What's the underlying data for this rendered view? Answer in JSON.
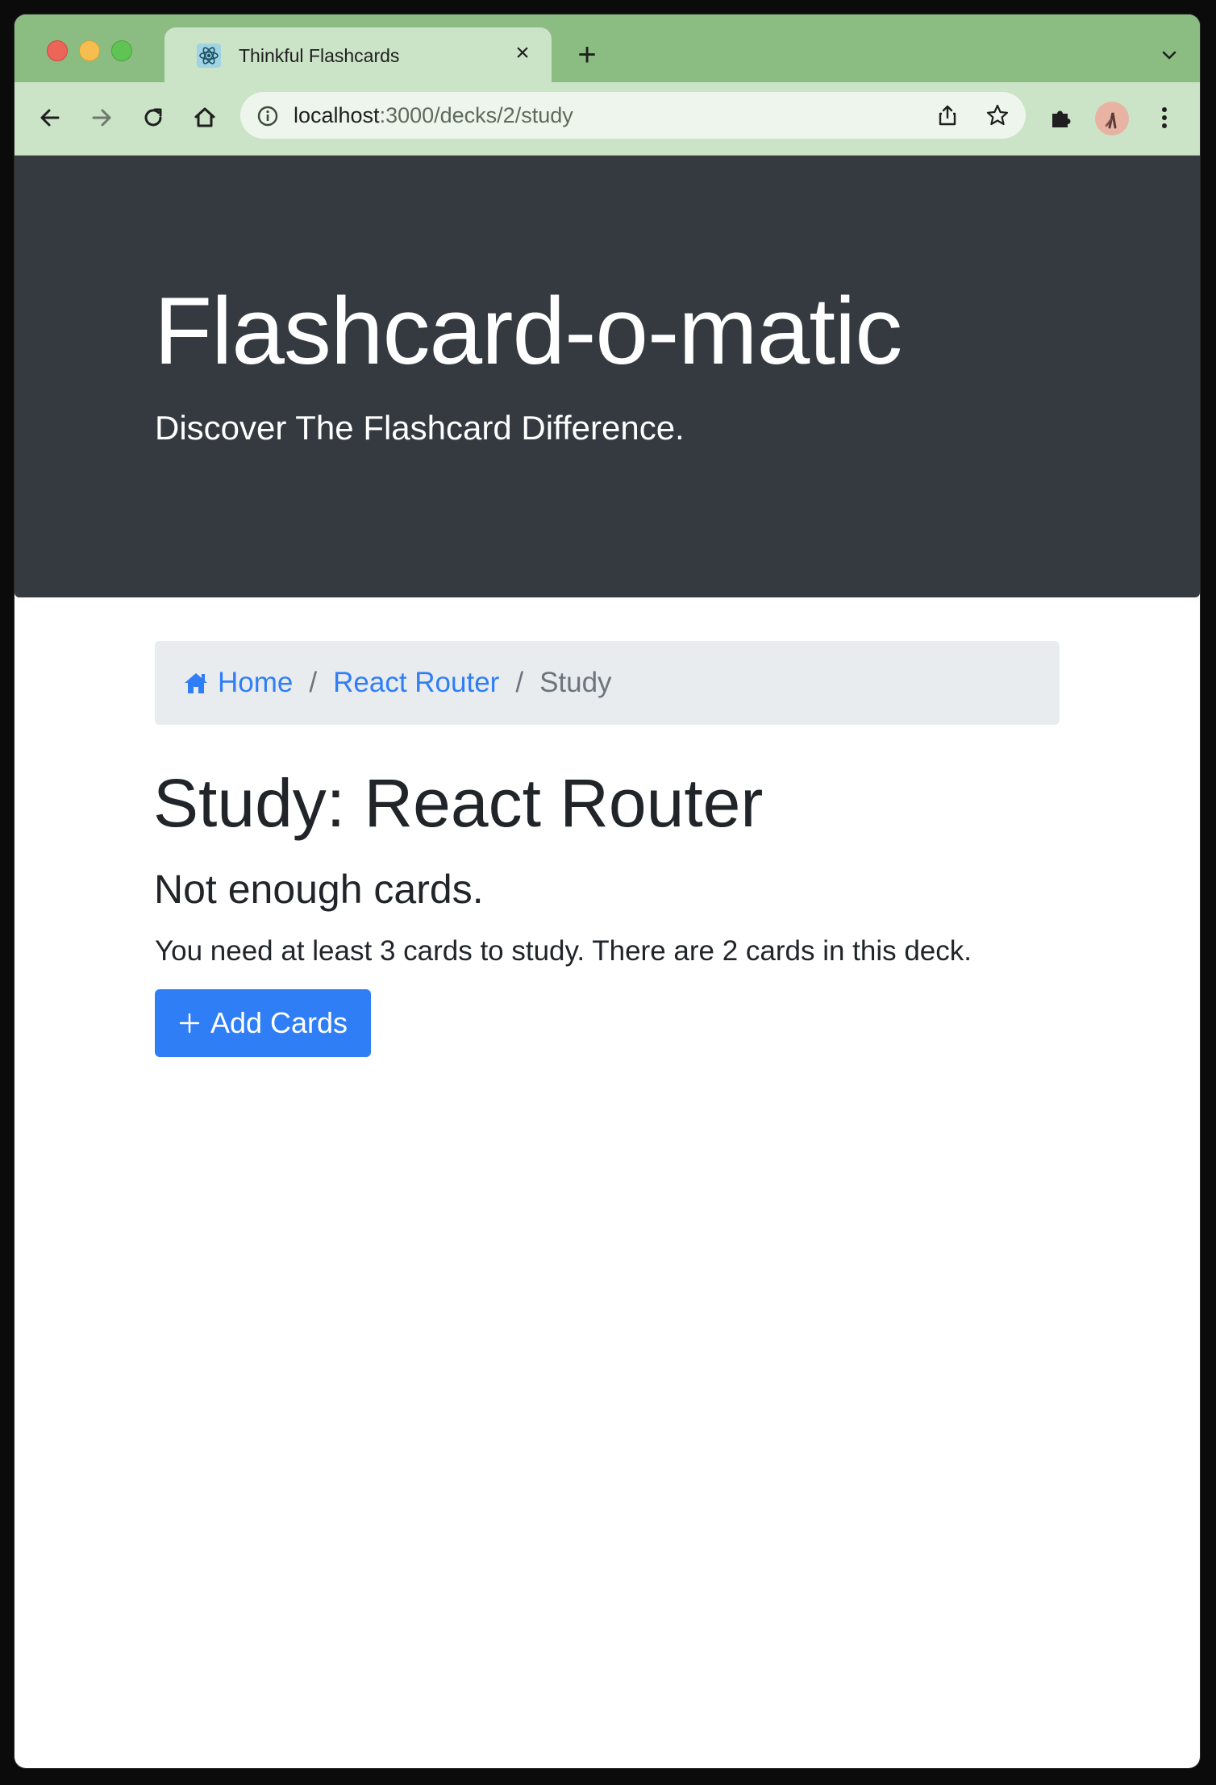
{
  "browser": {
    "tab": {
      "title": "Thinkful Flashcards",
      "favicon": "react-icon"
    },
    "url": {
      "host": "localhost",
      "path": ":3000/decks/2/study"
    }
  },
  "header": {
    "title": "Flashcard-o-matic",
    "subtitle": "Discover The Flashcard Difference."
  },
  "breadcrumb": {
    "home": "Home",
    "deck": "React Router",
    "current": "Study",
    "separator": "/"
  },
  "study": {
    "title": "Study: React Router",
    "heading": "Not enough cards.",
    "message": "You need at least 3 cards to study. There are 2 cards in this deck.",
    "add_button_label": "Add Cards"
  },
  "colors": {
    "tab_strip": "#8bbd83",
    "toolbar": "#cbe3c7",
    "jumbotron": "#343a40",
    "primary": "#2f7ef6",
    "breadcrumb_bg": "#e9ecef"
  }
}
